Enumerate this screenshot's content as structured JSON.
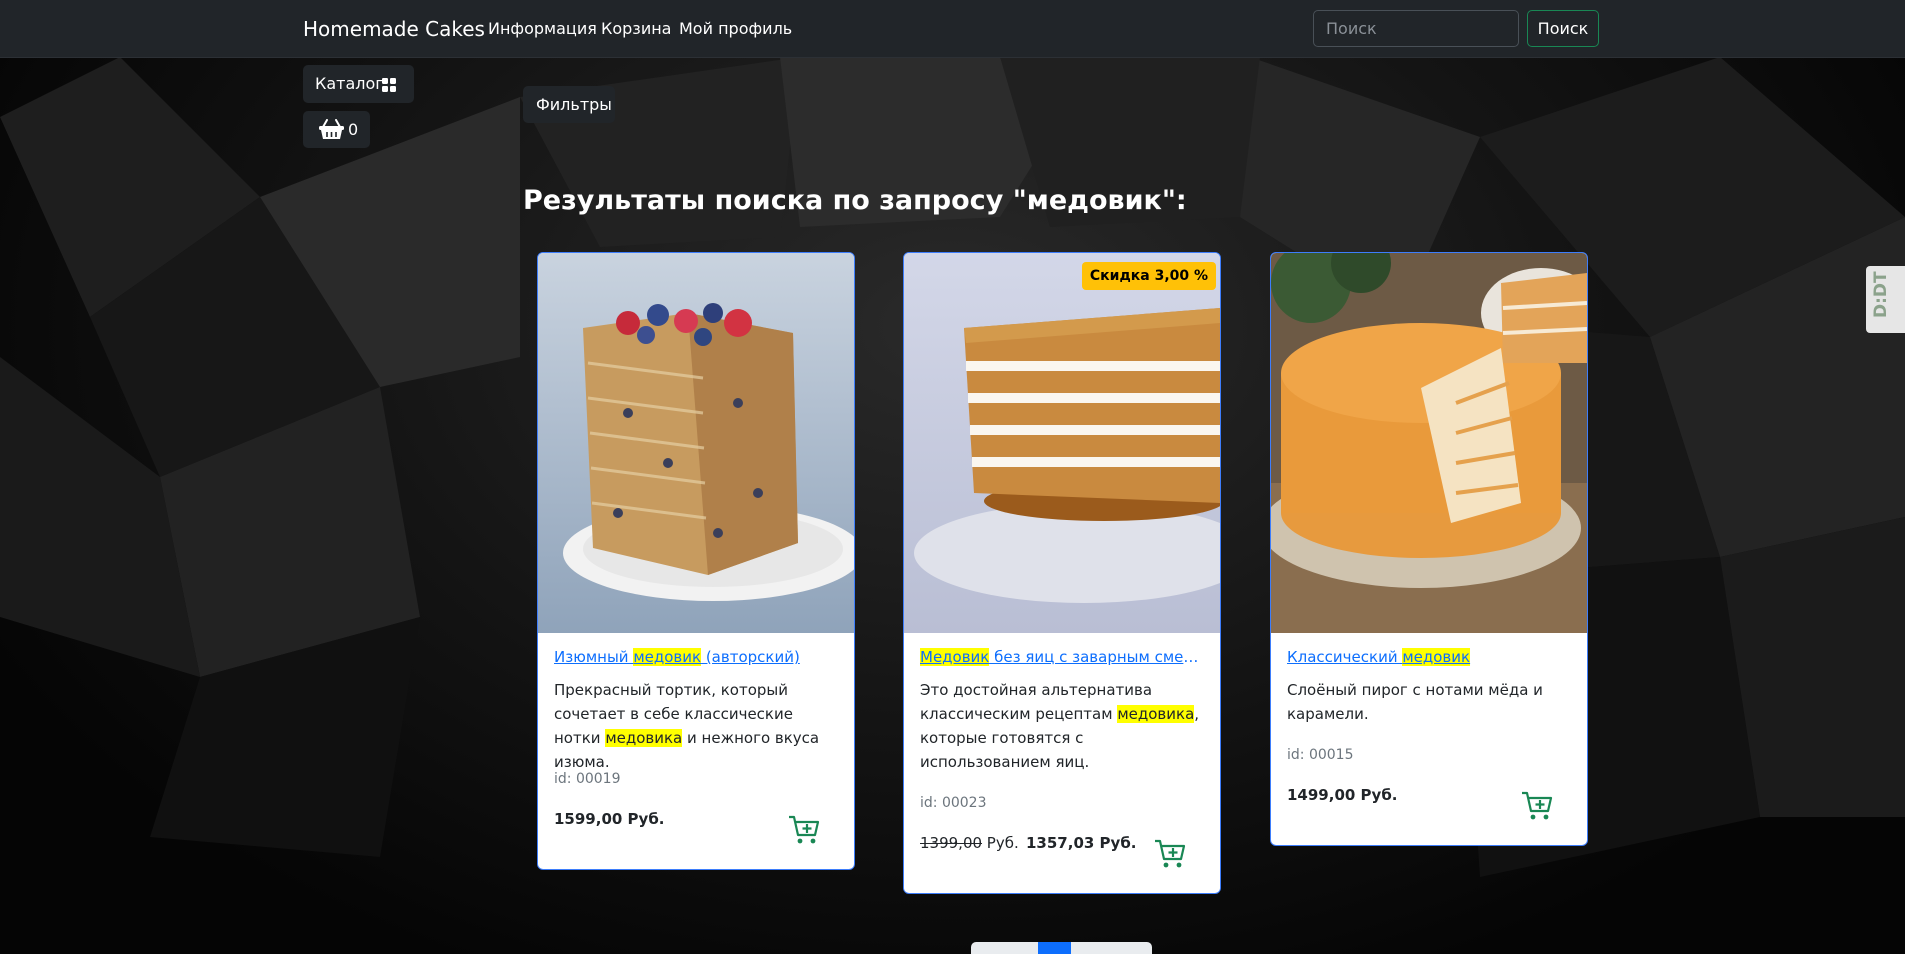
{
  "nav": {
    "brand": "Homemade Cakes",
    "links": [
      "Информация",
      "Корзина",
      "Мой профиль"
    ],
    "search_placeholder": "Поиск",
    "search_button": "Поиск"
  },
  "sidebar": {
    "catalog_label": "Каталог",
    "cart_count": "0"
  },
  "filters_label": "Фильтры",
  "heading": "Результаты поиска по запросу \"медовик\":",
  "products": [
    {
      "title_pre": "Изюмный ",
      "title_hl": "медовик",
      "title_post": " (авторский)",
      "desc_pre": "Прекрасный тортик, который сочетает в себе классические нотки ",
      "desc_hl": "медовика",
      "desc_post": " и нежного вкуса изюма.",
      "id": "id: 00019",
      "price": "1599,00 Руб."
    },
    {
      "title_pre": "",
      "title_hl": "Медовик",
      "title_post": " без яиц с заварным сметан...",
      "desc_pre": "Это достойная альтернатива классическим рецептам ",
      "desc_hl": "медовика",
      "desc_post": ", которые готовятся с использованием яиц.",
      "id": "id: 00023",
      "old_price": "1399,00",
      "old_currency": " Руб.",
      "price": "1357,03 Руб.",
      "discount": "Скидка 3,00 %"
    },
    {
      "title_pre": "Классический ",
      "title_hl": "медовик",
      "title_post": "",
      "desc_pre": "Слоёный пирог с нотами мёда и карамели.",
      "desc_hl": "",
      "desc_post": "",
      "id": "id: 00015",
      "price": "1499,00 Руб."
    }
  ],
  "extension_label": "D:DT",
  "colors": {
    "navbar": "#212529",
    "link": "#0d6efd",
    "highlight": "#ffff00",
    "discount_badge": "#ffc107",
    "cart_icon": "#198754",
    "card_border": "#3d7dfb"
  },
  "icons": [
    "grid-icon",
    "basket-icon",
    "cart-plus-icon"
  ]
}
